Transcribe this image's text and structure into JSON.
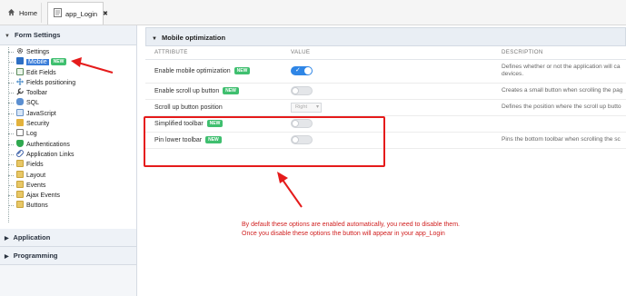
{
  "tabs": [
    {
      "label": "Home",
      "icon": "home-icon"
    },
    {
      "label": "app_Login",
      "icon": "page-icon",
      "close": "✖"
    }
  ],
  "sidebar": {
    "form_settings_label": "Form Settings",
    "items": [
      {
        "label": "Settings",
        "icon": "gear-icon"
      },
      {
        "label": "Mobile",
        "icon": "mobile-icon",
        "badge": "NEW",
        "selected": true
      },
      {
        "label": "Edit Fields",
        "icon": "edit-icon"
      },
      {
        "label": "Fields positioning",
        "icon": "move-icon"
      },
      {
        "label": "Toolbar",
        "icon": "wrench-icon"
      },
      {
        "label": "SQL",
        "icon": "database-icon"
      },
      {
        "label": "JavaScript",
        "icon": "script-icon"
      },
      {
        "label": "Security",
        "icon": "lock-icon"
      },
      {
        "label": "Log",
        "icon": "log-icon"
      },
      {
        "label": "Authentications",
        "icon": "shield-check-icon"
      },
      {
        "label": "Application Links",
        "icon": "link-icon"
      },
      {
        "label": "Fields",
        "icon": "folder-icon"
      },
      {
        "label": "Layout",
        "icon": "folder-icon"
      },
      {
        "label": "Events",
        "icon": "folder-icon"
      },
      {
        "label": "Ajax Events",
        "icon": "folder-icon"
      },
      {
        "label": "Buttons",
        "icon": "folder-icon"
      }
    ],
    "application_label": "Application",
    "programming_label": "Programming"
  },
  "main": {
    "panel_title": "Mobile optimization",
    "columns": {
      "attribute": "ATTRIBUTE",
      "value": "VALUE",
      "description": "DESCRIPTION"
    },
    "new_badge": "NEW",
    "rows": [
      {
        "attribute": "Enable mobile optimization",
        "badge": true,
        "type": "toggle",
        "on": true,
        "description": "Defines whether or not the application will ca",
        "description2": "devices."
      },
      {
        "attribute": "Enable scroll up button",
        "badge": true,
        "type": "toggle",
        "on": false,
        "description": "Creates a small button when scrolling the pag",
        "description2": ""
      },
      {
        "attribute": "Scroll up button position",
        "badge": false,
        "type": "select",
        "value": "Right",
        "description": "Defines the position where the scroll up butto",
        "description2": ""
      },
      {
        "attribute": "Simplified toolbar",
        "badge": true,
        "type": "toggle",
        "on": false,
        "description": "",
        "description2": ""
      },
      {
        "attribute": "Pin lower toolbar",
        "badge": true,
        "type": "toggle",
        "on": false,
        "description": "Pins the bottom toolbar when scrolling the sc",
        "description2": ""
      }
    ]
  },
  "annotation": {
    "line1": "By default these options are enabled automatically, you need to disable them.",
    "line2": "Once you disable these options the button will appear in your app_Login"
  },
  "colors": {
    "accent": "#2f86e6",
    "annotation_red": "#e51b1b",
    "badge_green": "#3fbf6f"
  }
}
